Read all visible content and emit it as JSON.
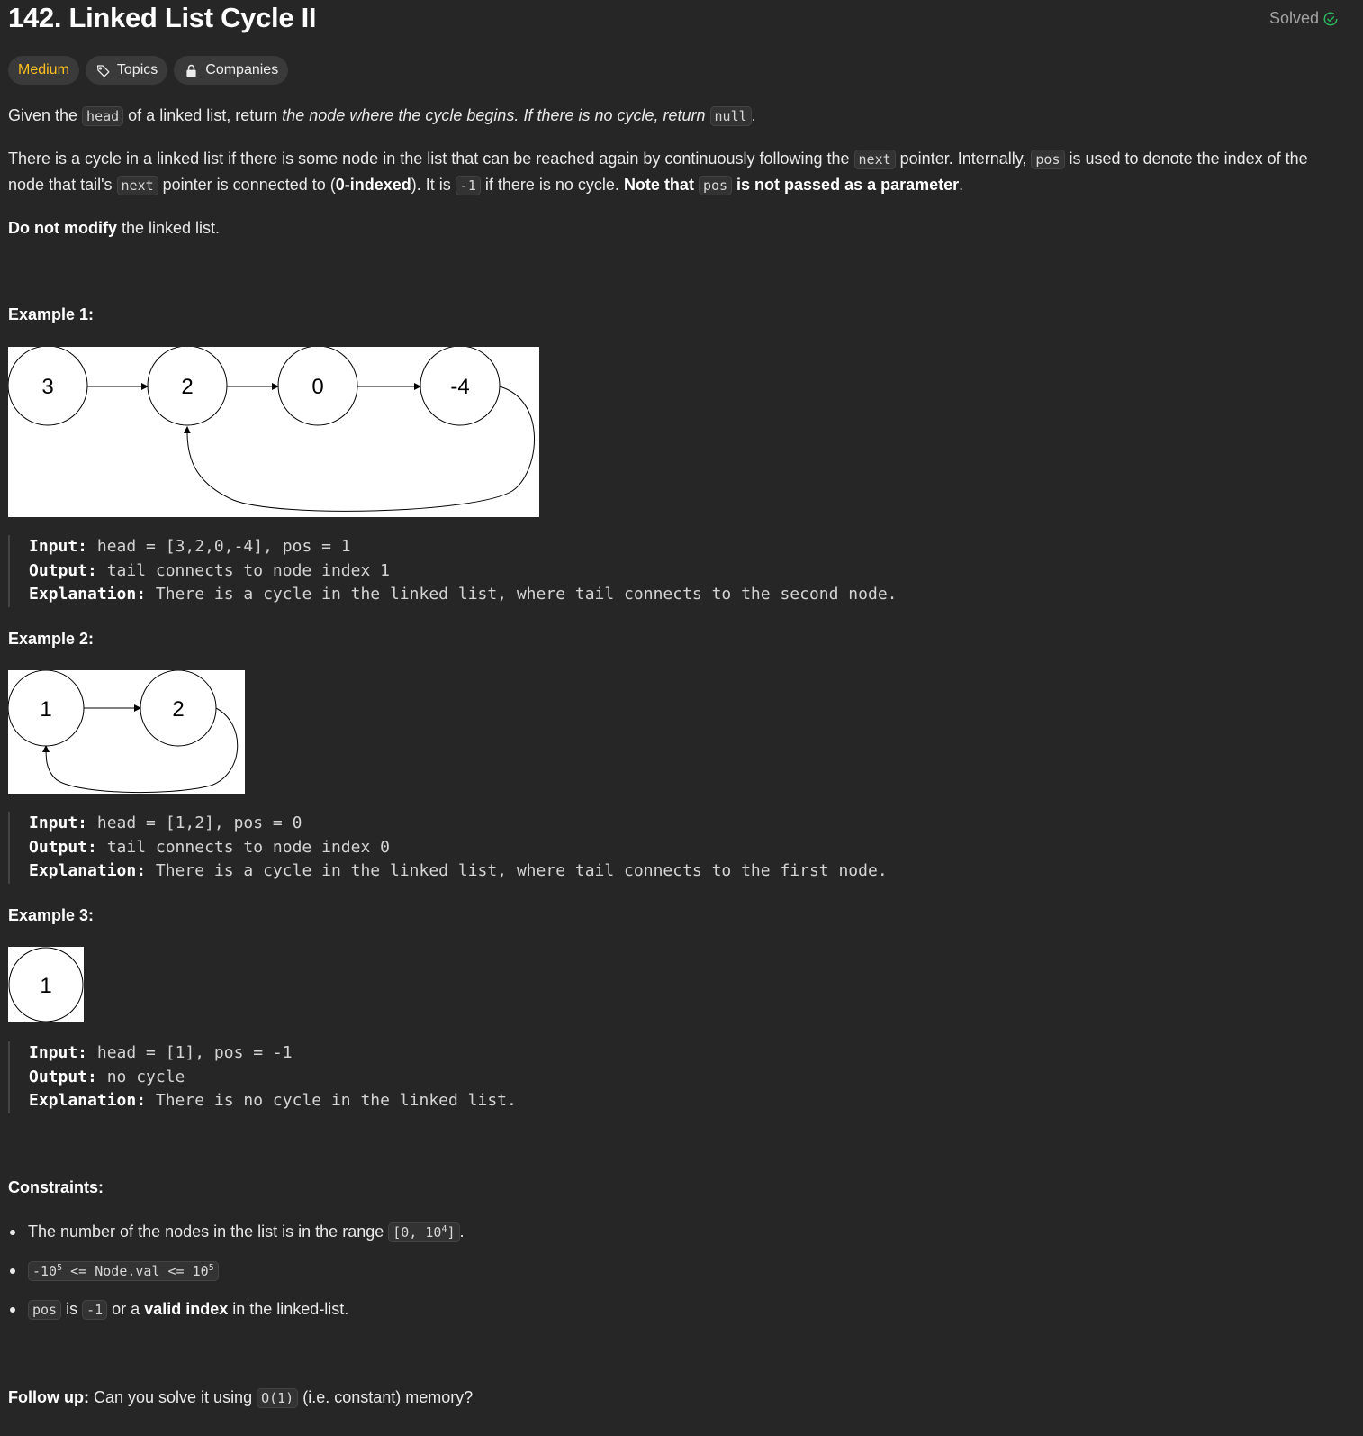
{
  "header": {
    "title": "142. Linked List Cycle II",
    "status": "Solved"
  },
  "tags": {
    "difficulty": "Medium",
    "topics": "Topics",
    "companies": "Companies"
  },
  "description": {
    "p1": {
      "a": "Given the ",
      "code_head": "head",
      "b": " of a linked list, return ",
      "em": "the node where the cycle begins. If there is no cycle, return ",
      "code_null": "null",
      "c": "."
    },
    "p2": {
      "a": "There is a cycle in a linked list if there is some node in the list that can be reached again by continuously following the ",
      "code_next": "next",
      "b": " pointer. Internally, ",
      "code_pos": "pos",
      "c": " is used to denote the index of the node that tail's ",
      "code_next2": "next",
      "d": " pointer is connected to (",
      "bold_zero": "0-indexed",
      "e": "). It is ",
      "code_minus1": "-1",
      "f": " if there is no cycle. ",
      "bold_note": "Note that ",
      "code_pos2": "pos",
      "bold_not": " is not passed as a parameter",
      "g": "."
    },
    "p3": {
      "bold": "Do not modify",
      "rest": " the linked list."
    }
  },
  "examples": [
    {
      "heading": "Example 1:",
      "nodes": [
        "3",
        "2",
        "0",
        "-4"
      ],
      "input_label": "Input:",
      "input": " head = [3,2,0,-4], pos = 1",
      "output_label": "Output:",
      "output": " tail connects to node index 1",
      "explanation_label": "Explanation:",
      "explanation": " There is a cycle in the linked list, where tail connects to the second node."
    },
    {
      "heading": "Example 2:",
      "nodes": [
        "1",
        "2"
      ],
      "input_label": "Input:",
      "input": " head = [1,2], pos = 0",
      "output_label": "Output:",
      "output": " tail connects to node index 0",
      "explanation_label": "Explanation:",
      "explanation": " There is a cycle in the linked list, where tail connects to the first node."
    },
    {
      "heading": "Example 3:",
      "nodes": [
        "1"
      ],
      "input_label": "Input:",
      "input": " head = [1], pos = -1",
      "output_label": "Output:",
      "output": " no cycle",
      "explanation_label": "Explanation:",
      "explanation": " There is no cycle in the linked list."
    }
  ],
  "constraints": {
    "heading": "Constraints:",
    "c1_text": "The number of the nodes in the list is in the range ",
    "c1_code_a": "[0, 10",
    "c1_code_sup": "4",
    "c1_code_b": "]",
    "c1_end": ".",
    "c2_a": "-10",
    "c2_sup1": "5",
    "c2_b": " <= Node.val <= 10",
    "c2_sup2": "5",
    "c3_code_pos": "pos",
    "c3_is": " is ",
    "c3_code_minus1": "-1",
    "c3_or": " or a ",
    "c3_bold": "valid index",
    "c3_end": " in the linked-list."
  },
  "follow_up": {
    "bold": "Follow up:",
    "a": " Can you solve it using ",
    "code": "O(1)",
    "b": " (i.e. constant) memory?"
  },
  "colors": {
    "background": "#262626",
    "difficulty_medium": "#ffc01e",
    "solved_check": "#2cbb5d"
  }
}
